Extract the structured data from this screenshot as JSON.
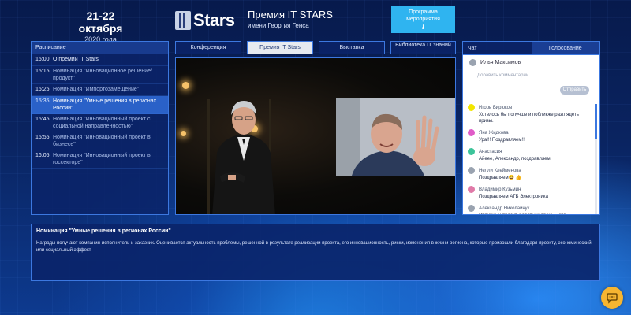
{
  "header": {
    "date": "21-22 октября",
    "year": "2020 года",
    "logo_text": "Stars",
    "title": "Премия IT STARS",
    "subtitle": "имени Георгия Генса",
    "program_button": "Программа мероприятия",
    "program_icon": "download-icon"
  },
  "schedule": {
    "heading": "Расписание",
    "items": [
      {
        "time": "15:00",
        "title": "О премии IT Stars"
      },
      {
        "time": "15:15",
        "title": "Номинация \"Инновационное решение/ продукт\""
      },
      {
        "time": "15:25",
        "title": "Номинация \"Импортозамещение\""
      },
      {
        "time": "15:35",
        "title": "Номинация \"Умные решения в регионах России\""
      },
      {
        "time": "15:45",
        "title": "Номинация \"Инновационный проект с социальной направленностью\""
      },
      {
        "time": "15:55",
        "title": "Номинация \"Инновационный проект в бизнесе\""
      },
      {
        "time": "16:05",
        "title": "Номинация \"Инновационный проект в госсекторе\""
      }
    ],
    "active_index": 3
  },
  "tabs": [
    {
      "label": "Конференция"
    },
    {
      "label": "Премия IT Stars"
    },
    {
      "label": "Выставка"
    },
    {
      "label": "Библиотека IT знаний"
    }
  ],
  "active_tab": 1,
  "chat": {
    "tab_chat": "Чат",
    "tab_vote": "Голосование",
    "current_user": "Илья Максимов",
    "placeholder": "Добавить комментарий",
    "send_label": "Отправить",
    "messages": [
      {
        "name": "Игорь Бирюков",
        "text": "Хотелось бы получше и побликже разглядеть призы.",
        "color": "#f2e600"
      },
      {
        "name": "Яна Жидкова",
        "text": "Ура!!! Поздравляем!!!",
        "color": "#e05cc8"
      },
      {
        "name": "Анастасия",
        "text": "Айеее, Александр, поздравляем!",
        "color": "#3cc49a"
      },
      {
        "name": "Нелли Клейменова",
        "text": "Поздравляем😀 👍",
        "color": "#9aa3b0"
      },
      {
        "name": "Владимир Кузьмин",
        "text": "Поздравляем АТБ Электроника",
        "color": "#e07aa8"
      },
      {
        "name": "Александр Николайчук",
        "text": "Отличный проект, роботы и дроны - это",
        "color": "#9aa3b0"
      }
    ]
  },
  "description": {
    "title": "Номинация \"Умные решения в регионах России\"",
    "text": "Награды получают компания-исполнитель и заказчик. Оценивается актуальность проблемы, решенной в результате реализации проекта, его инновационность, риски, изменения в жизни региона, которые произошли благодаря проекту, экономический или социальный эффект."
  },
  "fab_icon": "chat-bubble-icon"
}
